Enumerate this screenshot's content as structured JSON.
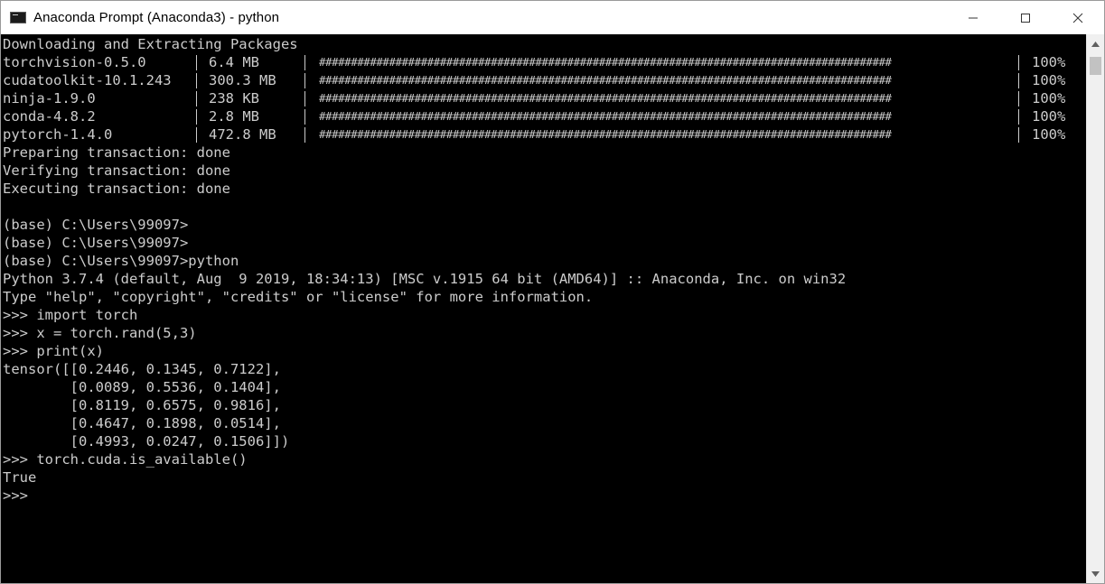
{
  "window": {
    "title": "Anaconda Prompt (Anaconda3) - python",
    "icon": "console-icon",
    "controls": [
      "minimize-icon",
      "maximize-icon",
      "close-icon"
    ]
  },
  "console": {
    "header": "Downloading and Extracting Packages",
    "packages": [
      {
        "name": "torchvision-0.5.0",
        "size": "6.4 MB",
        "progress": "##########################################################################################",
        "percent": "100%"
      },
      {
        "name": "cudatoolkit-10.1.243",
        "size": "300.3 MB",
        "progress": "##########################################################################################",
        "percent": "100%"
      },
      {
        "name": "ninja-1.9.0",
        "size": "238 KB",
        "progress": "##########################################################################################",
        "percent": "100%"
      },
      {
        "name": "conda-4.8.2",
        "size": "2.8 MB",
        "progress": "##########################################################################################",
        "percent": "100%"
      },
      {
        "name": "pytorch-1.4.0",
        "size": "472.8 MB",
        "progress": "##########################################################################################",
        "percent": "100%"
      }
    ],
    "lines_after": [
      "Preparing transaction: done",
      "Verifying transaction: done",
      "Executing transaction: done",
      "",
      "(base) C:\\Users\\99097>",
      "(base) C:\\Users\\99097>",
      "(base) C:\\Users\\99097>python",
      "Python 3.7.4 (default, Aug  9 2019, 18:34:13) [MSC v.1915 64 bit (AMD64)] :: Anaconda, Inc. on win32",
      "Type \"help\", \"copyright\", \"credits\" or \"license\" for more information.",
      ">>> import torch",
      ">>> x = torch.rand(5,3)",
      ">>> print(x)",
      "tensor([[0.2446, 0.1345, 0.7122],",
      "        [0.0089, 0.5536, 0.1404],",
      "        [0.8119, 0.6575, 0.9816],",
      "        [0.4647, 0.1898, 0.0514],",
      "        [0.4993, 0.0247, 0.1506]])",
      ">>> torch.cuda.is_available()",
      "True",
      ">>>"
    ]
  },
  "scrollbar": {
    "up_icon": "scroll-up-arrow-icon",
    "down_icon": "scroll-down-arrow-icon"
  }
}
